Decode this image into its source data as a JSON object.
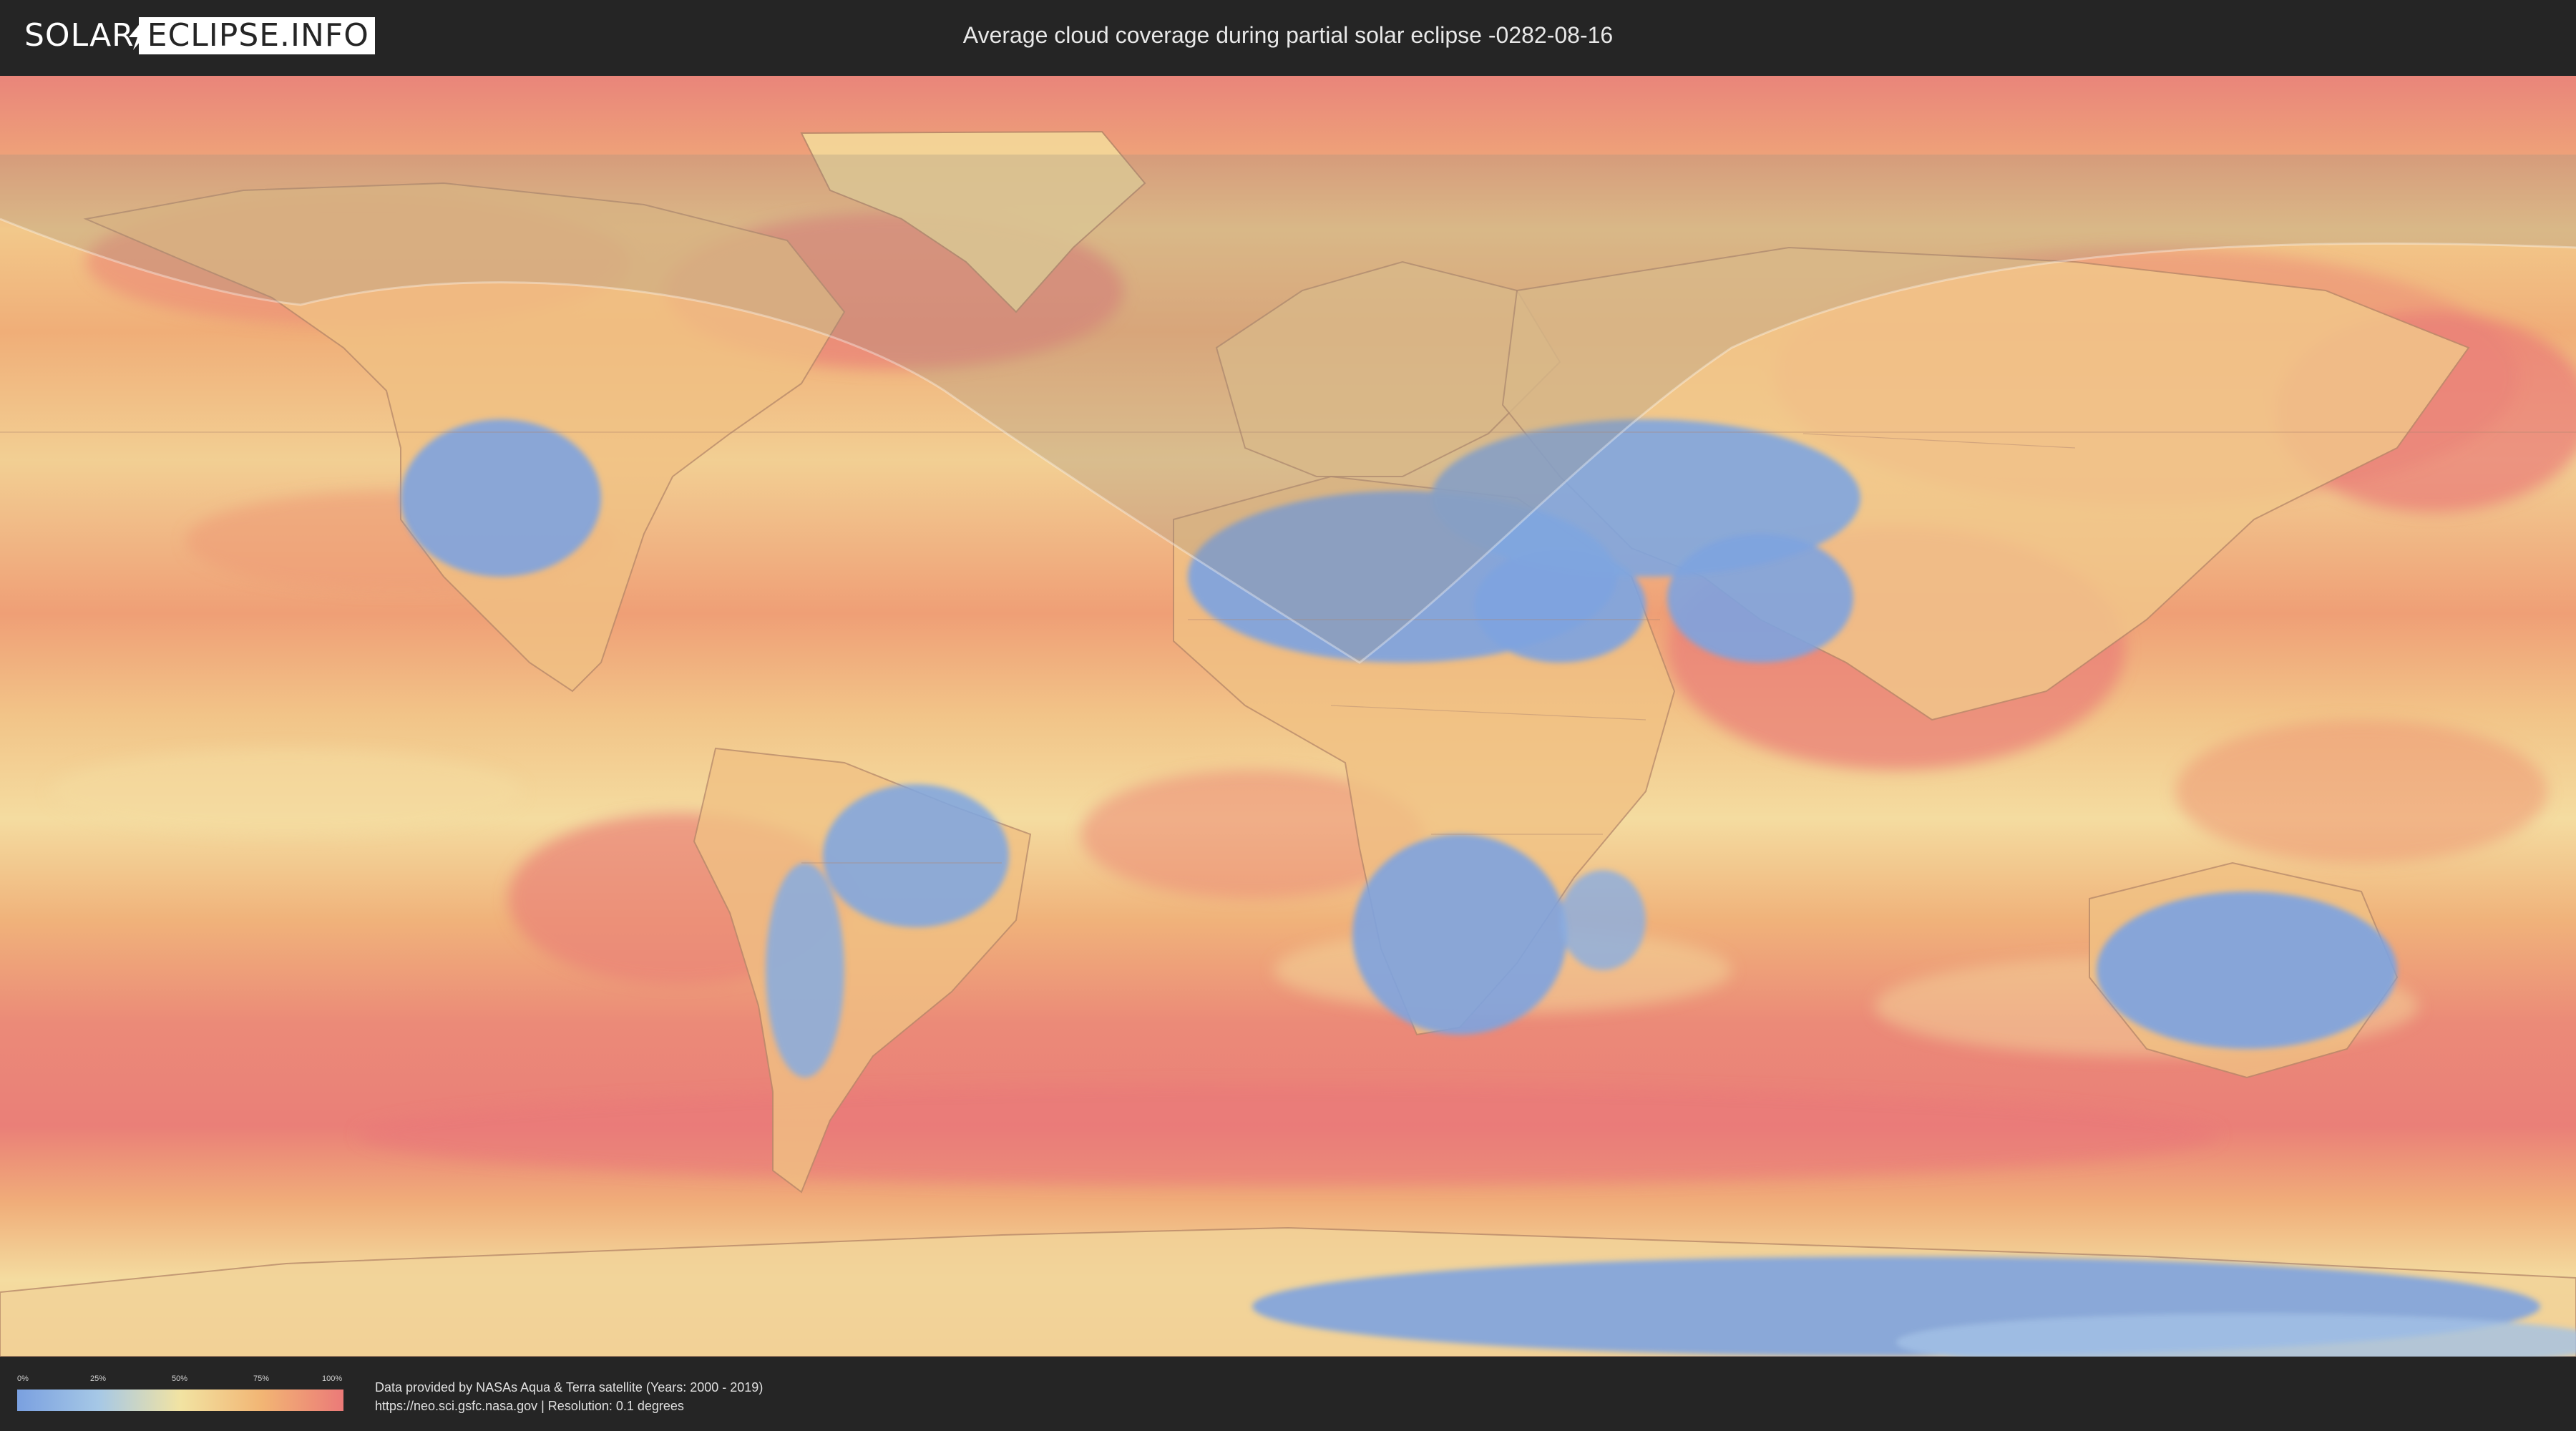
{
  "header": {
    "logo_left": "SOLAR",
    "logo_right": "ECLIPSE.INFO",
    "title": "Average cloud coverage during partial solar eclipse -0282-08-16"
  },
  "map": {
    "colors": {
      "clear": "#7ea3df",
      "low": "#a9c9e6",
      "mid": "#f2e2a0",
      "high": "#f1b072",
      "overcast": "#e8797a"
    }
  },
  "legend": {
    "ticks": [
      "0%",
      "25%",
      "50%",
      "75%",
      "100%"
    ],
    "values": [
      0,
      25,
      50,
      75,
      100
    ]
  },
  "footer": {
    "credit_line1": "Data provided by NASAs Aqua & Terra satellite (Years: 2000 - 2019)",
    "credit_line2": "https://neo.sci.gsfc.nasa.gov | Resolution: 0.1 degrees"
  }
}
